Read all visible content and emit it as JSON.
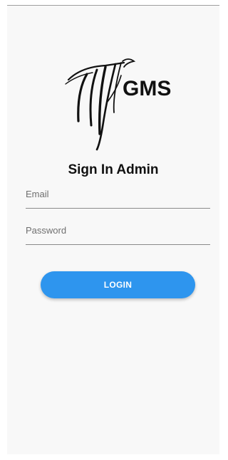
{
  "logo": {
    "text": "GMS"
  },
  "title": "Sign In Admin",
  "form": {
    "email_placeholder": "Email",
    "password_placeholder": "Password",
    "email_value": "",
    "password_value": ""
  },
  "login_button": {
    "label": "LOGIN"
  },
  "colors": {
    "accent": "#2e95ee",
    "background": "#f8f8f8",
    "text": "#111111"
  }
}
